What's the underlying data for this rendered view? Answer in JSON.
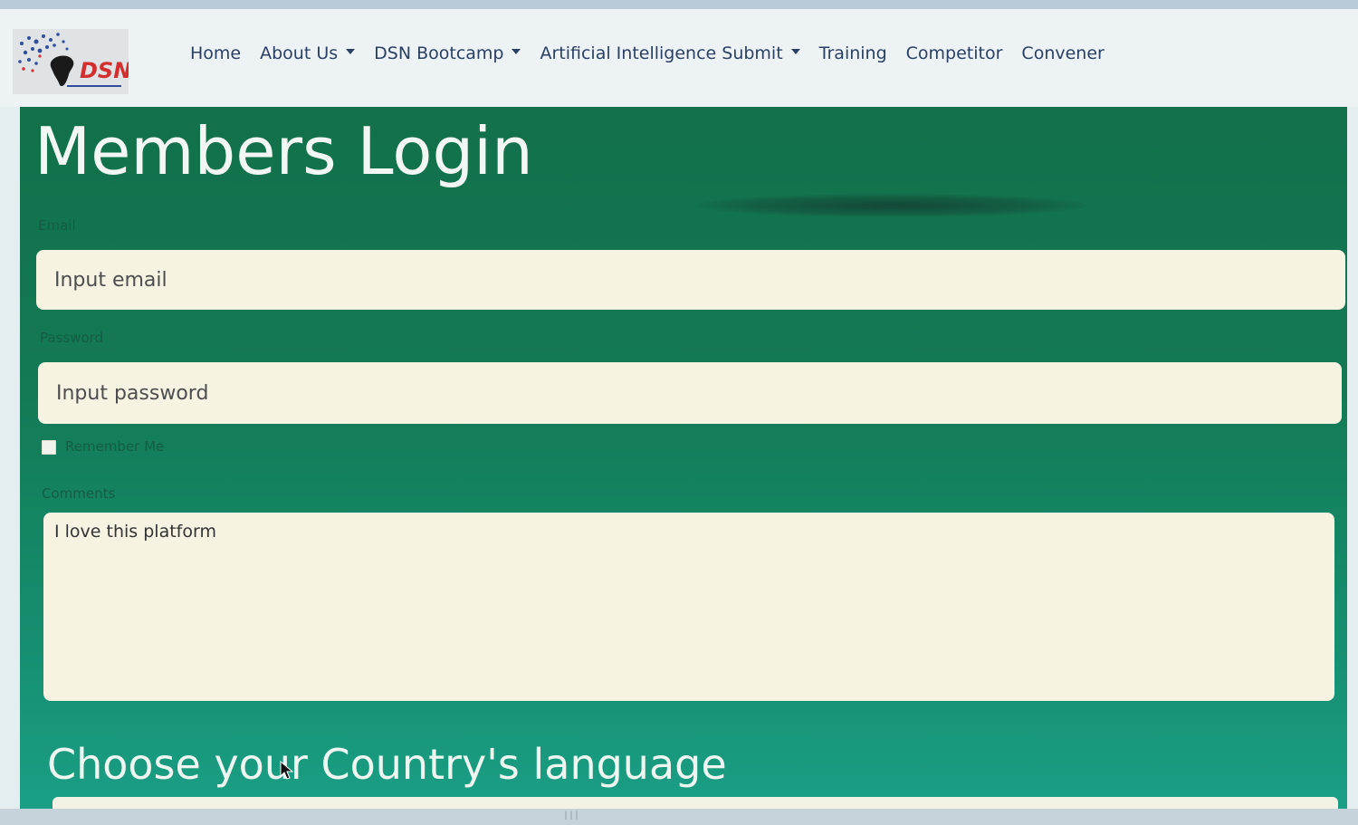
{
  "brand": {
    "logo_text": "DSN"
  },
  "nav": {
    "items": [
      {
        "label": "Home",
        "dropdown": false
      },
      {
        "label": "About Us",
        "dropdown": true
      },
      {
        "label": "DSN Bootcamp",
        "dropdown": true
      },
      {
        "label": "Artificial Intelligence Submit",
        "dropdown": true
      },
      {
        "label": "Training",
        "dropdown": false
      },
      {
        "label": "Competitor",
        "dropdown": false
      },
      {
        "label": "Convener",
        "dropdown": false
      }
    ]
  },
  "login": {
    "title": "Members Login",
    "email_label": "Email",
    "email_placeholder": "Input email",
    "password_label": "Password",
    "password_placeholder": "Input password",
    "remember_label": "Remember Me",
    "remember_checked": false,
    "comments_label": "Comments",
    "comments_value": "I love this platform"
  },
  "language": {
    "heading": "Choose your Country's language"
  },
  "colors": {
    "nav_text": "#2b3f63",
    "panel_green": "#137a55",
    "field_background": "#f7f3e3",
    "logo_red": "#d32f2f"
  }
}
